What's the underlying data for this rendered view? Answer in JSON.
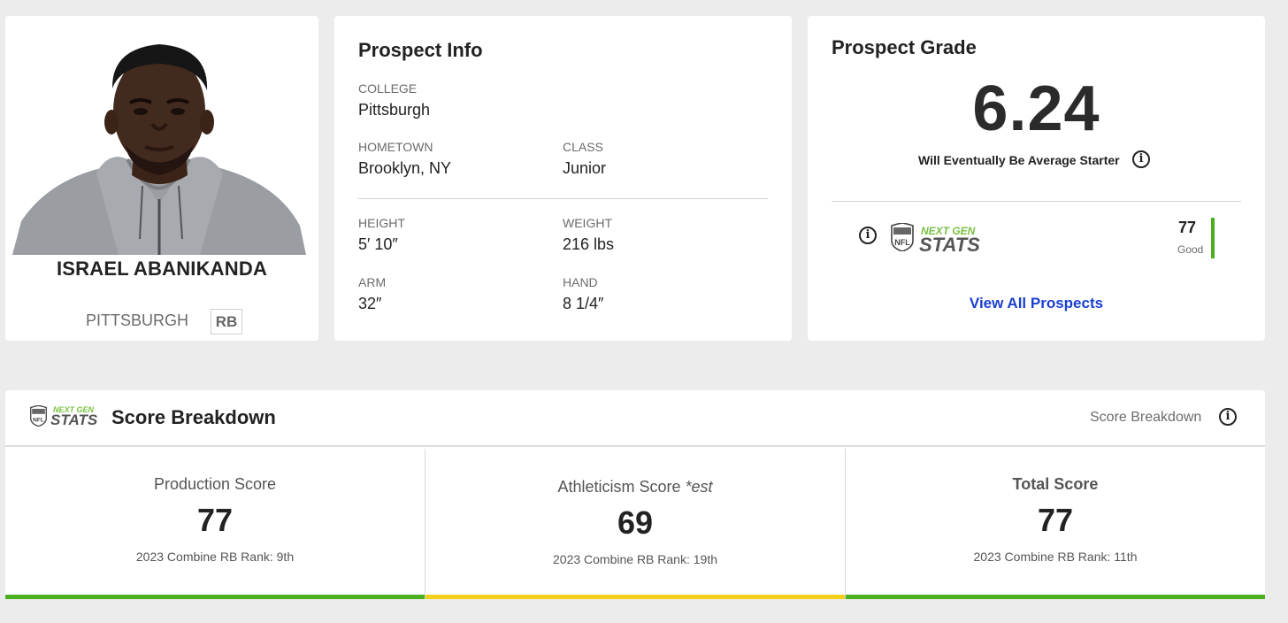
{
  "player": {
    "name": "ISRAEL ABANIKANDA",
    "school": "PITTSBURGH",
    "position": "RB"
  },
  "prospect_info": {
    "title": "Prospect Info",
    "college_label": "COLLEGE",
    "college": "Pittsburgh",
    "hometown_label": "HOMETOWN",
    "hometown": "Brooklyn, NY",
    "class_label": "CLASS",
    "class": "Junior",
    "height_label": "HEIGHT",
    "height": "5′ 10″",
    "weight_label": "WEIGHT",
    "weight": "216 lbs",
    "arm_label": "ARM",
    "arm": "32″",
    "hand_label": "HAND",
    "hand": "8 1/4″"
  },
  "prospect_grade": {
    "title": "Prospect Grade",
    "grade": "6.24",
    "description": "Will Eventually Be Average Starter",
    "ngs_score": "77",
    "ngs_rating": "Good",
    "view_all": "View All Prospects"
  },
  "logo": {
    "line1": "NEXT GEN",
    "line2": "STATS",
    "shield": "NFL"
  },
  "score_breakdown": {
    "title": "Score Breakdown",
    "right_label": "Score Breakdown",
    "columns": [
      {
        "title": "Production Score",
        "value": "77",
        "rank": "2023 Combine RB Rank: 9th",
        "color": "#4caf1f"
      },
      {
        "title": "Athleticism Score",
        "title_suffix": "*est",
        "value": "69",
        "rank": "2023 Combine RB Rank: 19th",
        "color": "#f2d01a"
      },
      {
        "title": "Total Score",
        "value": "77",
        "rank": "2023 Combine RB Rank: 11th",
        "color": "#4caf1f"
      }
    ]
  },
  "colors": {
    "accent_green": "#4caf1f",
    "accent_yellow": "#f2d01a",
    "link_blue": "#1a3fd1",
    "ngs_green": "#7ac143"
  },
  "icons": [
    "info-icon",
    "nfl-shield-icon",
    "player-photo"
  ]
}
